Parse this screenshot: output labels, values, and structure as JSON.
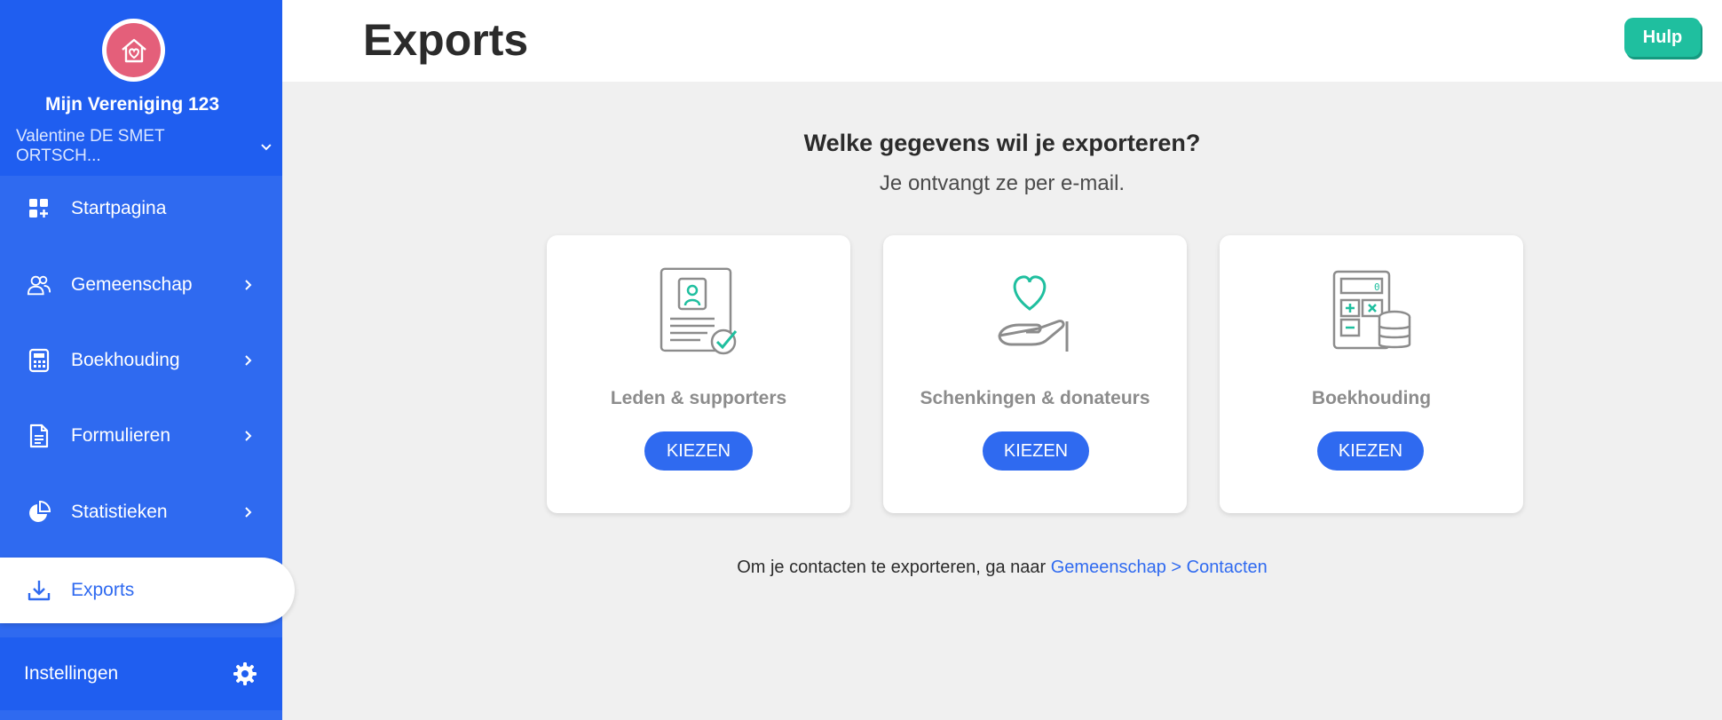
{
  "sidebar": {
    "org_name": "Mijn Vereniging 123",
    "user_name": "Valentine DE SMET ORTSCH...",
    "items": [
      {
        "label": "Startpagina",
        "icon": "dashboard-icon"
      },
      {
        "label": "Gemeenschap",
        "icon": "users-icon"
      },
      {
        "label": "Boekhouding",
        "icon": "calculator-icon"
      },
      {
        "label": "Formulieren",
        "icon": "document-icon"
      },
      {
        "label": "Statistieken",
        "icon": "pie-chart-icon"
      },
      {
        "label": "Exports",
        "icon": "download-icon"
      }
    ],
    "settings_label": "Instellingen"
  },
  "header": {
    "title": "Exports",
    "help_label": "Hulp"
  },
  "main": {
    "question": "Welke gegevens wil je exporteren?",
    "subtitle": "Je ontvangt ze per e-mail.",
    "cards": [
      {
        "title": "Leden & supporters",
        "button": "KIEZEN",
        "icon": "member-card-icon"
      },
      {
        "title": "Schenkingen & donateurs",
        "button": "KIEZEN",
        "icon": "donation-hand-icon"
      },
      {
        "title": "Boekhouding",
        "button": "KIEZEN",
        "icon": "calculator-coins-icon"
      }
    ],
    "footer_text": "Om je contacten te exporteren, ga naar",
    "footer_link": "Gemeenschap > Contacten"
  },
  "colors": {
    "primary": "#2f6af0",
    "sidebar_dark": "#1f5ef0",
    "help": "#1fbf9f",
    "logo": "#e45f7a",
    "icon_accent": "#1fbf9f"
  }
}
